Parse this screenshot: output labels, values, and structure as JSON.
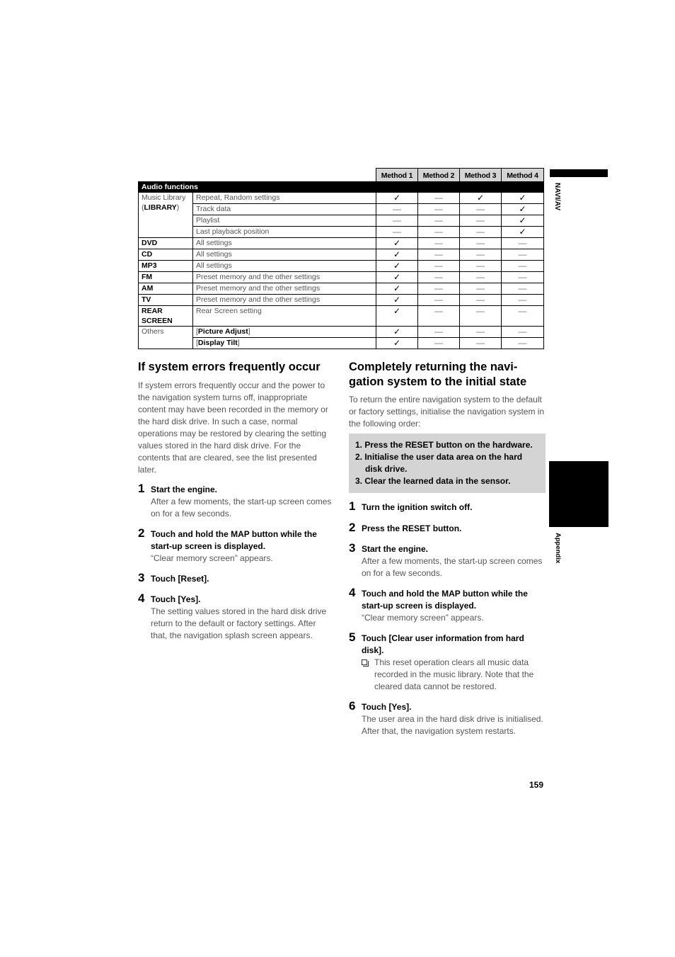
{
  "table": {
    "method_headers": [
      "Method 1",
      "Method 2",
      "Method 3",
      "Method 4"
    ],
    "section_label": "Audio functions",
    "rows": [
      {
        "category": "Music Library",
        "category_sub": "LIBRARY",
        "description": "Repeat, Random settings",
        "marks": [
          "✓",
          "—",
          "✓",
          "✓"
        ]
      },
      {
        "description": "Track data",
        "marks": [
          "—",
          "—",
          "—",
          "✓"
        ]
      },
      {
        "description": "Playlist",
        "marks": [
          "—",
          "—",
          "—",
          "✓"
        ]
      },
      {
        "description": "Last playback position",
        "marks": [
          "—",
          "—",
          "—",
          "✓"
        ]
      },
      {
        "category": "DVD",
        "description": "All settings",
        "marks": [
          "✓",
          "—",
          "—",
          "—"
        ]
      },
      {
        "category": "CD",
        "description": "All settings",
        "marks": [
          "✓",
          "—",
          "—",
          "—"
        ]
      },
      {
        "category": "MP3",
        "description": "All settings",
        "marks": [
          "✓",
          "—",
          "—",
          "—"
        ]
      },
      {
        "category": "FM",
        "description": "Preset memory and the other settings",
        "marks": [
          "✓",
          "—",
          "—",
          "—"
        ]
      },
      {
        "category": "AM",
        "description": "Preset memory and the other settings",
        "marks": [
          "✓",
          "—",
          "—",
          "—"
        ]
      },
      {
        "category": "TV",
        "description": "Preset memory and the other settings",
        "marks": [
          "✓",
          "—",
          "—",
          "—"
        ]
      },
      {
        "category_line1": "REAR",
        "category_line2": "SCREEN",
        "description": "Rear Screen setting",
        "marks": [
          "✓",
          "—",
          "—",
          "—"
        ]
      },
      {
        "category": "Others",
        "description": "Picture Adjust",
        "marks": [
          "✓",
          "—",
          "—",
          "—"
        ]
      },
      {
        "description": "Display Tilt",
        "marks": [
          "✓",
          "—",
          "—",
          "—"
        ]
      }
    ]
  },
  "side_tabs": {
    "top": "NAVI/AV",
    "bottom": "Appendix"
  },
  "left_section": {
    "heading": "If system errors frequently occur",
    "intro": "If system errors frequently occur and the power to the navigation system turns off, inappropriate content may have been recorded in the memory or the hard disk drive. In such a case, normal operations may be restored by clearing the setting values stored in the hard disk drive. For the contents that are cleared, see the list presented later.",
    "steps": [
      {
        "num": "1",
        "title": "Start the engine.",
        "body": "After a few moments, the start-up screen comes on for a few seconds."
      },
      {
        "num": "2",
        "title": "Touch and hold the MAP button while the start-up screen is displayed.",
        "body": "“Clear memory screen” appears."
      },
      {
        "num": "3",
        "title": "Touch [Reset].",
        "body": ""
      },
      {
        "num": "4",
        "title": "Touch [Yes].",
        "body": "The setting values stored in the hard disk drive return to the default or factory settings. After that, the navigation splash screen appears."
      }
    ]
  },
  "right_section": {
    "heading_line1": "Completely returning the navi-",
    "heading_line2": "gation system to the initial state",
    "intro": "To return the entire navigation system to the default or factory settings, initialise the navigation system in the following order:",
    "order": [
      "1. Press the RESET button on the hardware.",
      "2. Initialise the user data area on the hard disk drive.",
      "3. Clear the learned data in the sensor."
    ],
    "steps": [
      {
        "num": "1",
        "title": "Turn the ignition switch off.",
        "body": ""
      },
      {
        "num": "2",
        "title": "Press the RESET button.",
        "body": ""
      },
      {
        "num": "3",
        "title": "Start the engine.",
        "body": "After a few moments, the start-up screen comes on for a few seconds."
      },
      {
        "num": "4",
        "title": "Touch and hold the MAP button while the start-up screen is displayed.",
        "body": "“Clear memory screen” appears."
      },
      {
        "num": "5",
        "title": "Touch [Clear user information from hard disk].",
        "body": "",
        "note": "This reset operation clears all music data recorded in the music library. Note that the cleared data cannot be restored."
      },
      {
        "num": "6",
        "title": "Touch [Yes].",
        "body": "The user area in the hard disk drive is initialised. After that, the navigation system restarts."
      }
    ]
  },
  "page_number": "159"
}
